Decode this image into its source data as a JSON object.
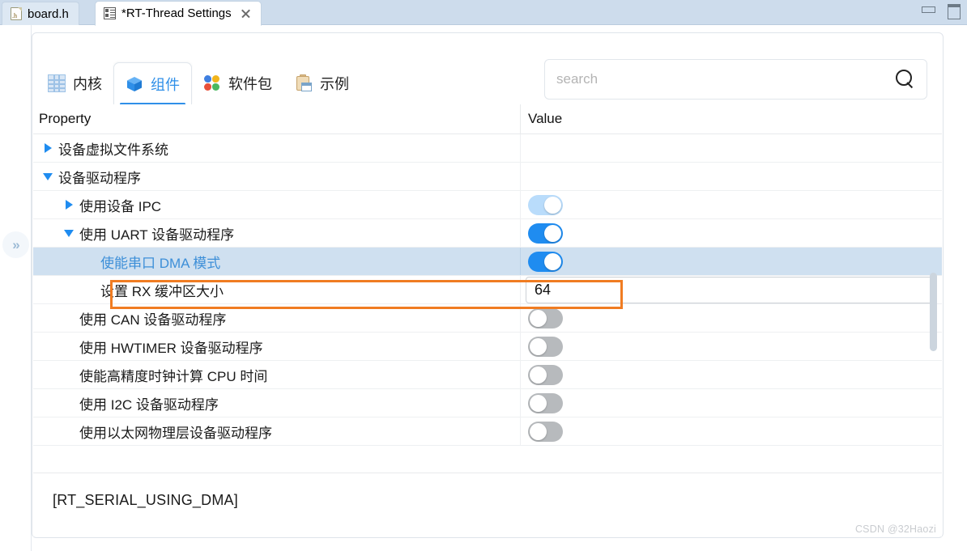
{
  "window": {
    "minimize_label": "minimize",
    "maximize_label": "maximize"
  },
  "editor_tabs": [
    {
      "label": "board.h",
      "icon": "h-file-icon",
      "active": false,
      "closable": false
    },
    {
      "label": "*RT-Thread Settings",
      "icon": "settings-icon",
      "active": true,
      "closable": true
    }
  ],
  "left_rail": {
    "restore_label": "»"
  },
  "categories": [
    {
      "label": "内核",
      "icon": "kernel-grid-icon",
      "selected": false
    },
    {
      "label": "组件",
      "icon": "components-cube-icon",
      "selected": true
    },
    {
      "label": "软件包",
      "icon": "packages-flower-icon",
      "selected": false
    },
    {
      "label": "示例",
      "icon": "examples-clipboard-icon",
      "selected": false
    }
  ],
  "search": {
    "placeholder": "search",
    "value": "",
    "icon": "search-icon"
  },
  "table": {
    "columns": [
      "Property",
      "Value"
    ],
    "rows": [
      {
        "label": "设备虚拟文件系统",
        "indent": 0,
        "expander": "closed",
        "value_type": "none",
        "value": "",
        "selected": false
      },
      {
        "label": "设备驱动程序",
        "indent": 0,
        "expander": "open",
        "value_type": "none",
        "value": "",
        "selected": false
      },
      {
        "label": "使用设备 IPC",
        "indent": 1,
        "expander": "closed",
        "value_type": "toggle",
        "value": "dim",
        "selected": false
      },
      {
        "label": "使用 UART 设备驱动程序",
        "indent": 1,
        "expander": "open",
        "value_type": "toggle",
        "value": "on",
        "selected": false
      },
      {
        "label": "使能串口 DMA 模式",
        "indent": 2,
        "expander": "none",
        "value_type": "toggle",
        "value": "on",
        "selected": true
      },
      {
        "label": "设置 RX 缓冲区大小",
        "indent": 2,
        "expander": "none",
        "value_type": "number",
        "value": "64",
        "selected": false
      },
      {
        "label": "使用 CAN 设备驱动程序",
        "indent": 1,
        "expander": "none",
        "value_type": "toggle",
        "value": "off",
        "selected": false
      },
      {
        "label": "使用 HWTIMER 设备驱动程序",
        "indent": 1,
        "expander": "none",
        "value_type": "toggle",
        "value": "off",
        "selected": false
      },
      {
        "label": "使能高精度时钟计算 CPU 时间",
        "indent": 1,
        "expander": "none",
        "value_type": "toggle",
        "value": "off",
        "selected": false
      },
      {
        "label": "使用 I2C 设备驱动程序",
        "indent": 1,
        "expander": "none",
        "value_type": "toggle",
        "value": "off",
        "selected": false
      },
      {
        "label": "使用以太网物理层设备驱动程序",
        "indent": 1,
        "expander": "none",
        "value_type": "toggle",
        "value": "off",
        "selected": false
      }
    ]
  },
  "description": {
    "text": "[RT_SERIAL_USING_DMA]"
  },
  "watermark": {
    "text": "CSDN @32Haozi"
  },
  "colors": {
    "accent_blue": "#1f8cf0",
    "focus_orange": "#f07c22",
    "selection_blue": "#cfe0f0",
    "titlebar_blue": "#cddcec"
  }
}
